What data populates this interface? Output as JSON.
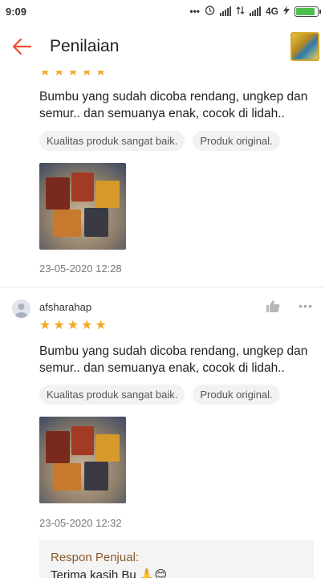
{
  "status_bar": {
    "time": "9:09",
    "network": "4G",
    "icons": [
      "dots-icon",
      "alarm-icon",
      "signal-icon",
      "data-arrows-icon",
      "signal-icon",
      "charging-icon",
      "battery-icon"
    ]
  },
  "header": {
    "title": "Penilaian",
    "back_icon": "arrow-left-icon"
  },
  "colors": {
    "accent": "#ee4d2d",
    "star": "#f6a623",
    "seller_title": "#8a5a2b"
  },
  "reviews": [
    {
      "stars": 5,
      "text": "Bumbu yang sudah dicoba rendang, ungkep dan semur.. dan semuanya enak, cocok di lidah..",
      "tags": [
        "Kualitas produk sangat baik.",
        "Produk original."
      ],
      "date": "23-05-2020 12:28"
    },
    {
      "username": "afsharahap",
      "stars": 5,
      "text": "Bumbu yang sudah dicoba rendang, ungkep dan semur.. dan semuanya enak, cocok di lidah..",
      "tags": [
        "Kualitas produk sangat baik.",
        "Produk original."
      ],
      "date": "23-05-2020 12:32",
      "seller_response": {
        "title": "Respon Penjual:",
        "text": "Terima kasih Bu 🙏😊"
      }
    }
  ]
}
